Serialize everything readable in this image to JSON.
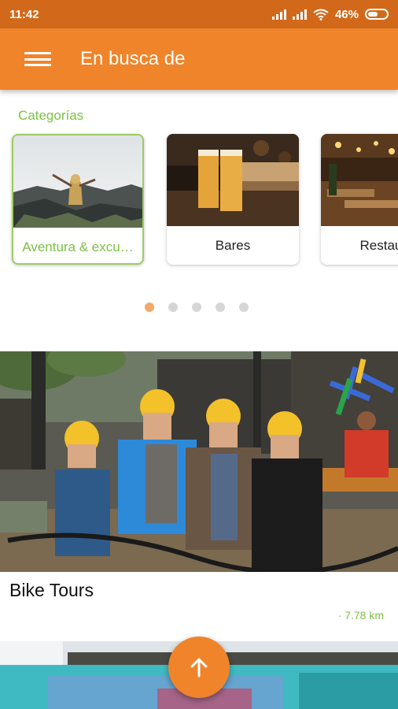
{
  "status_bar": {
    "time": "11:42",
    "battery_percent": "46%",
    "icons": [
      "signal-icon",
      "signal-icon",
      "wifi-icon",
      "battery-icon"
    ]
  },
  "app_bar": {
    "title": "En busca de",
    "menu_icon": "hamburger-menu-icon"
  },
  "categories": {
    "heading": "Categorías",
    "items": [
      {
        "label": "Aventura & excu…",
        "selected": true
      },
      {
        "label": "Bares",
        "selected": false
      },
      {
        "label": "Restaura",
        "selected": false
      }
    ],
    "page_count": 5,
    "current_page": 1
  },
  "featured": {
    "title": "Bike Tours",
    "distance": "· 7.78 km"
  },
  "fab": {
    "icon": "arrow-up-icon"
  },
  "colors": {
    "status_bar": "#d2691a",
    "app_bar": "#f0842b",
    "accent_green": "#7cc144",
    "dot_active": "#f3a86a",
    "dot_inactive": "#d6d6d6"
  }
}
